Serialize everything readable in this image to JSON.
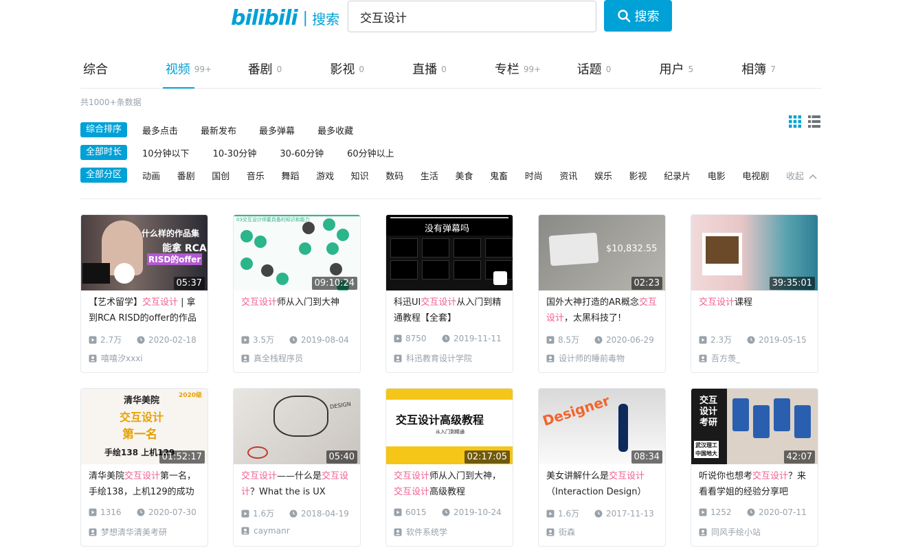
{
  "header": {
    "logo_text": "bilibili",
    "logo_sep": "|",
    "logo_sub": "搜索",
    "search_value": "交互设计",
    "search_button": "搜索"
  },
  "tabs": [
    {
      "label": "综合",
      "count": ""
    },
    {
      "label": "视频",
      "count": "99+"
    },
    {
      "label": "番剧",
      "count": "0"
    },
    {
      "label": "影视",
      "count": "0"
    },
    {
      "label": "直播",
      "count": "0"
    },
    {
      "label": "专栏",
      "count": "99+"
    },
    {
      "label": "话题",
      "count": "0"
    },
    {
      "label": "用户",
      "count": "5"
    },
    {
      "label": "相簿",
      "count": "7"
    }
  ],
  "total": "共1000+条数据",
  "filters": {
    "sort": {
      "active": "综合排序",
      "options": [
        "最多点击",
        "最新发布",
        "最多弹幕",
        "最多收藏"
      ]
    },
    "duration": {
      "active": "全部时长",
      "options": [
        "10分钟以下",
        "10-30分钟",
        "30-60分钟",
        "60分钟以上"
      ]
    },
    "zone": {
      "active": "全部分区",
      "options": [
        "动画",
        "番剧",
        "国创",
        "音乐",
        "舞蹈",
        "游戏",
        "知识",
        "数码",
        "生活",
        "美食",
        "鬼畜",
        "时尚",
        "资讯",
        "娱乐",
        "影视",
        "纪录片",
        "电影",
        "电视剧"
      ],
      "collapse": "收起"
    }
  },
  "colors": {
    "accent": "#00a1d6",
    "highlight": "#f25d8e",
    "muted": "#99a2aa"
  },
  "videos": [
    {
      "duration": "05:37",
      "title_parts": [
        [
          "【艺术留学】",
          false
        ],
        [
          "交互设计",
          true
        ],
        [
          " | 拿到RCA RISD的offer的作品",
          false
        ]
      ],
      "plays": "2.7万",
      "date": "2020-02-18",
      "uploader": "嘻嘻汐xxxi",
      "thumb_text": [
        "什么样的作品集",
        "能拿 RCA",
        "RISD的offer"
      ]
    },
    {
      "duration": "09:10:24",
      "title_parts": [
        [
          "交互设计",
          true
        ],
        [
          "师从入门到大神",
          false
        ]
      ],
      "plays": "3.5万",
      "date": "2019-08-04",
      "uploader": "真全栈程序员",
      "thumb_text": [
        "03交互设计师要具备的知识和能力"
      ]
    },
    {
      "duration": "",
      "title_parts": [
        [
          "科迅UI",
          false
        ],
        [
          "交互设计",
          true
        ],
        [
          "从入门到精通教程【全套】",
          false
        ]
      ],
      "plays": "8750",
      "date": "2019-11-11",
      "uploader": "科迅教育设计学院",
      "thumb_text": [
        "没有弹幕吗"
      ]
    },
    {
      "duration": "02:23",
      "title_parts": [
        [
          "国外大神打造的AR概念",
          false
        ],
        [
          "交互设计",
          true
        ],
        [
          "，太黑科技了!",
          false
        ]
      ],
      "plays": "8.5万",
      "date": "2020-06-29",
      "uploader": "设计师的睡前毒物",
      "thumb_text": [
        "$10,832.55"
      ]
    },
    {
      "duration": "39:35:01",
      "title_parts": [
        [
          "交互设计",
          true
        ],
        [
          "课程",
          false
        ]
      ],
      "plays": "2.3万",
      "date": "2019-05-15",
      "uploader": "吾方羡_",
      "thumb_text": []
    },
    {
      "duration": "01:52:17",
      "title_parts": [
        [
          "清华美院",
          false
        ],
        [
          "交互设计",
          true
        ],
        [
          "第一名，手绘138，上机129的成功",
          false
        ]
      ],
      "plays": "1316",
      "date": "2020-07-30",
      "uploader": "梦想清华清美考研",
      "thumb_text": [
        "清华美院",
        "交互设计",
        "第一名",
        "手绘138 上机129",
        "2020级"
      ]
    },
    {
      "duration": "05:40",
      "title_parts": [
        [
          "交互设计",
          true
        ],
        [
          "——什么是",
          false
        ],
        [
          "交互设计",
          true
        ],
        [
          "？What the is UX Design",
          false
        ]
      ],
      "plays": "1.6万",
      "date": "2018-04-19",
      "uploader": "caymanr",
      "thumb_text": [
        "DESIGN"
      ]
    },
    {
      "duration": "02:17:05",
      "title_parts": [
        [
          "交互设计",
          true
        ],
        [
          "师从入门到大神，",
          false
        ],
        [
          "交互设计",
          true
        ],
        [
          "高级教程",
          false
        ]
      ],
      "plays": "6015",
      "date": "2019-10-24",
      "uploader": "软件系统学",
      "thumb_text": [
        "交互设计高级教程",
        "从入门到精通"
      ]
    },
    {
      "duration": "08:34",
      "title_parts": [
        [
          "美女讲解什么是",
          false
        ],
        [
          "交互设计",
          true
        ],
        [
          "（Interaction Design）",
          false
        ]
      ],
      "plays": "1.6万",
      "date": "2017-11-13",
      "uploader": "街森",
      "thumb_text": [
        "Designer"
      ]
    },
    {
      "duration": "42:07",
      "title_parts": [
        [
          "听说你也想考",
          false
        ],
        [
          "交互设计",
          true
        ],
        [
          "？来看看学姐的经验分享吧",
          false
        ]
      ],
      "plays": "1252",
      "date": "2020-07-11",
      "uploader": "同风手绘小站",
      "thumb_text": [
        "交互",
        "设计",
        "考研",
        "武汉理工",
        "中国地大"
      ]
    }
  ]
}
